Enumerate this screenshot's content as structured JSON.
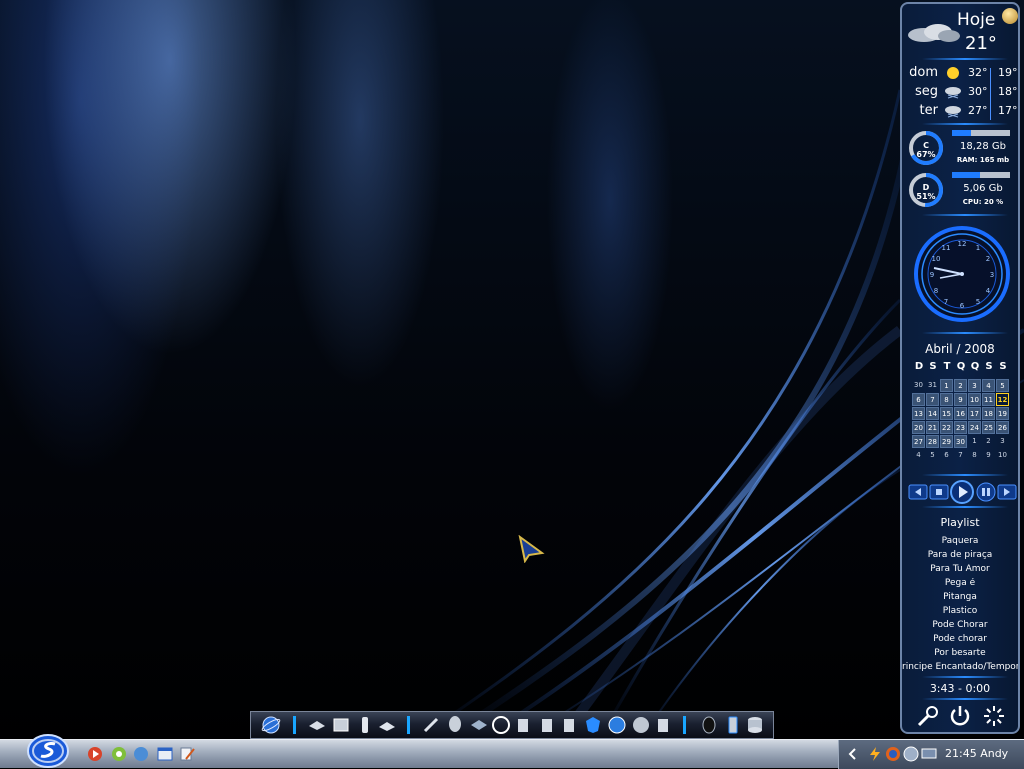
{
  "weather": {
    "title": "Hoje",
    "temp": "21°",
    "forecast": [
      {
        "day": "dom",
        "icon": "sun-icon",
        "hi": "32°",
        "lo": "19°"
      },
      {
        "day": "seg",
        "icon": "cloud-rain-icon",
        "hi": "30°",
        "lo": "18°"
      },
      {
        "day": "ter",
        "icon": "cloud-rain-icon",
        "hi": "27°",
        "lo": "17°"
      }
    ]
  },
  "drives": [
    {
      "letter": "C",
      "percent": "67%",
      "size": "18,28 Gb",
      "sub": "RAM: 165 mb",
      "fill": 0.33
    },
    {
      "letter": "D",
      "percent": "51%",
      "size": "5,06 Gb",
      "sub": "CPU: 20 %",
      "fill": 0.49
    }
  ],
  "clock_widget": {
    "hour": 3,
    "minute": 45
  },
  "calendar": {
    "title": "Abril / 2008",
    "headers": [
      "D",
      "S",
      "T",
      "Q",
      "Q",
      "S",
      "S"
    ],
    "weeks": [
      [
        {
          "d": "30",
          "t": "other"
        },
        {
          "d": "31",
          "t": "other"
        },
        {
          "d": "1",
          "t": "cur"
        },
        {
          "d": "2",
          "t": "cur"
        },
        {
          "d": "3",
          "t": "cur"
        },
        {
          "d": "4",
          "t": "cur"
        },
        {
          "d": "5",
          "t": "cur"
        }
      ],
      [
        {
          "d": "6",
          "t": "cur"
        },
        {
          "d": "7",
          "t": "cur"
        },
        {
          "d": "8",
          "t": "cur"
        },
        {
          "d": "9",
          "t": "cur"
        },
        {
          "d": "10",
          "t": "cur"
        },
        {
          "d": "11",
          "t": "cur"
        },
        {
          "d": "12",
          "t": "today"
        }
      ],
      [
        {
          "d": "13",
          "t": "cur"
        },
        {
          "d": "14",
          "t": "cur"
        },
        {
          "d": "15",
          "t": "cur"
        },
        {
          "d": "16",
          "t": "cur"
        },
        {
          "d": "17",
          "t": "cur"
        },
        {
          "d": "18",
          "t": "cur"
        },
        {
          "d": "19",
          "t": "cur"
        }
      ],
      [
        {
          "d": "20",
          "t": "cur"
        },
        {
          "d": "21",
          "t": "cur"
        },
        {
          "d": "22",
          "t": "cur"
        },
        {
          "d": "23",
          "t": "cur"
        },
        {
          "d": "24",
          "t": "cur"
        },
        {
          "d": "25",
          "t": "cur"
        },
        {
          "d": "26",
          "t": "cur"
        }
      ],
      [
        {
          "d": "27",
          "t": "cur"
        },
        {
          "d": "28",
          "t": "cur"
        },
        {
          "d": "29",
          "t": "cur"
        },
        {
          "d": "30",
          "t": "cur"
        },
        {
          "d": "1",
          "t": "other"
        },
        {
          "d": "2",
          "t": "other"
        },
        {
          "d": "3",
          "t": "other"
        }
      ],
      [
        {
          "d": "4",
          "t": "other"
        },
        {
          "d": "5",
          "t": "other"
        },
        {
          "d": "6",
          "t": "other"
        },
        {
          "d": "7",
          "t": "other"
        },
        {
          "d": "8",
          "t": "other"
        },
        {
          "d": "9",
          "t": "other"
        },
        {
          "d": "10",
          "t": "other"
        }
      ]
    ]
  },
  "media": {
    "buttons": [
      "prev-icon",
      "stop-icon",
      "play-icon",
      "pause-icon",
      "next-icon"
    ]
  },
  "playlist": {
    "title": "Playlist",
    "items": [
      "Paquera",
      "Para de piraça",
      "Para Tu Amor",
      "Pega é",
      "Pitanga",
      "Plastico",
      "Pode Chorar",
      "Pode chorar",
      "Por besarte",
      "rincipe Encantado/Tempor"
    ],
    "time": "3:43 - 0:00"
  },
  "system_buttons": [
    "wrench-icon",
    "power-icon",
    "loading-icon"
  ],
  "dock": {
    "icons": [
      "globe-icon",
      "|",
      "folder-icon",
      "drive-icon",
      "usb-icon",
      "mail-icon",
      "|",
      "tools-icon",
      "alien-icon",
      "network-icon",
      "moon-icon",
      "recycle-icon",
      "recycle-icon",
      "recycle-icon",
      "shield-icon",
      "ie-icon",
      "user-icon",
      "recycle-icon",
      "|",
      "mouse-icon",
      "phone-icon",
      "database-icon"
    ]
  },
  "taskbar": {
    "quicklaunch": [
      "media-player-icon",
      "refresh-icon",
      "network-icon",
      "window-icon",
      "edit-icon"
    ],
    "tray_icons": [
      "chevron-left-icon",
      "flash-icon",
      "firefox-icon",
      "globe-icon",
      "display-icon"
    ],
    "clock": "21:45 Andy"
  },
  "colors": {
    "accent": "#1f7cff",
    "today": "#ffd21f"
  }
}
